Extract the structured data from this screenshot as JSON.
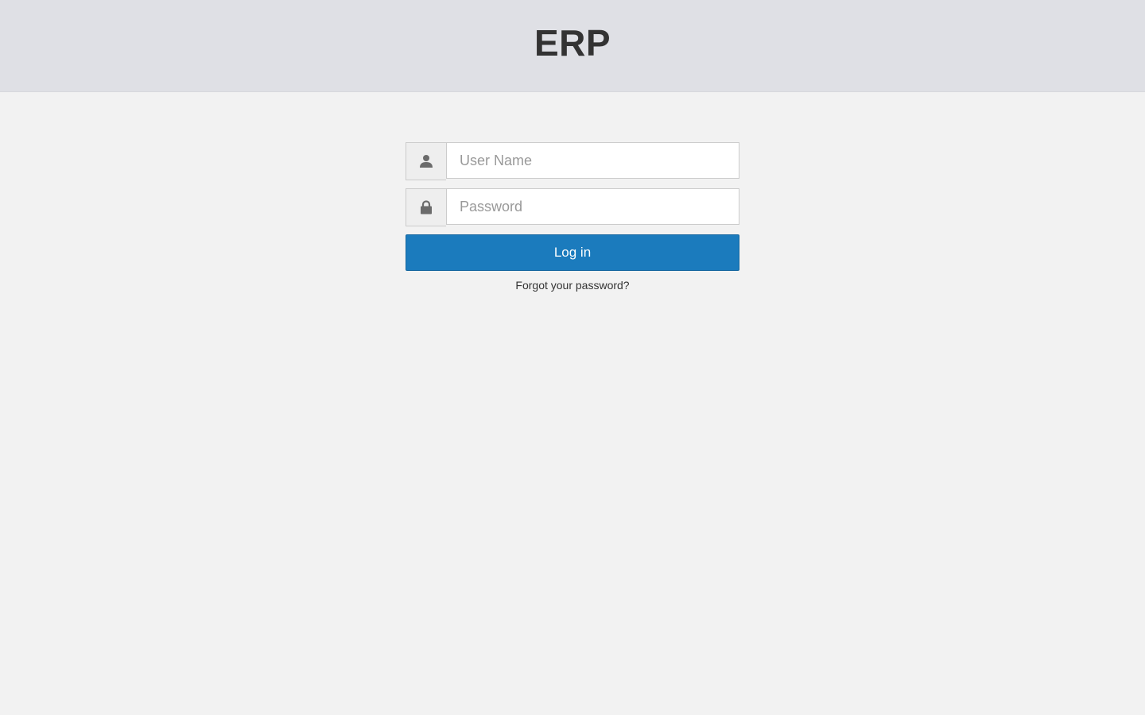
{
  "header": {
    "title": "ERP"
  },
  "login_form": {
    "username": {
      "placeholder": "User Name",
      "value": "",
      "icon": "user-icon"
    },
    "password": {
      "placeholder": "Password",
      "value": "",
      "icon": "lock-icon"
    },
    "submit_label": "Log in",
    "forgot_link": "Forgot your password?"
  },
  "colors": {
    "header_bg": "#dfe0e5",
    "page_bg": "#f2f2f2",
    "primary": "#1b7bbd"
  }
}
